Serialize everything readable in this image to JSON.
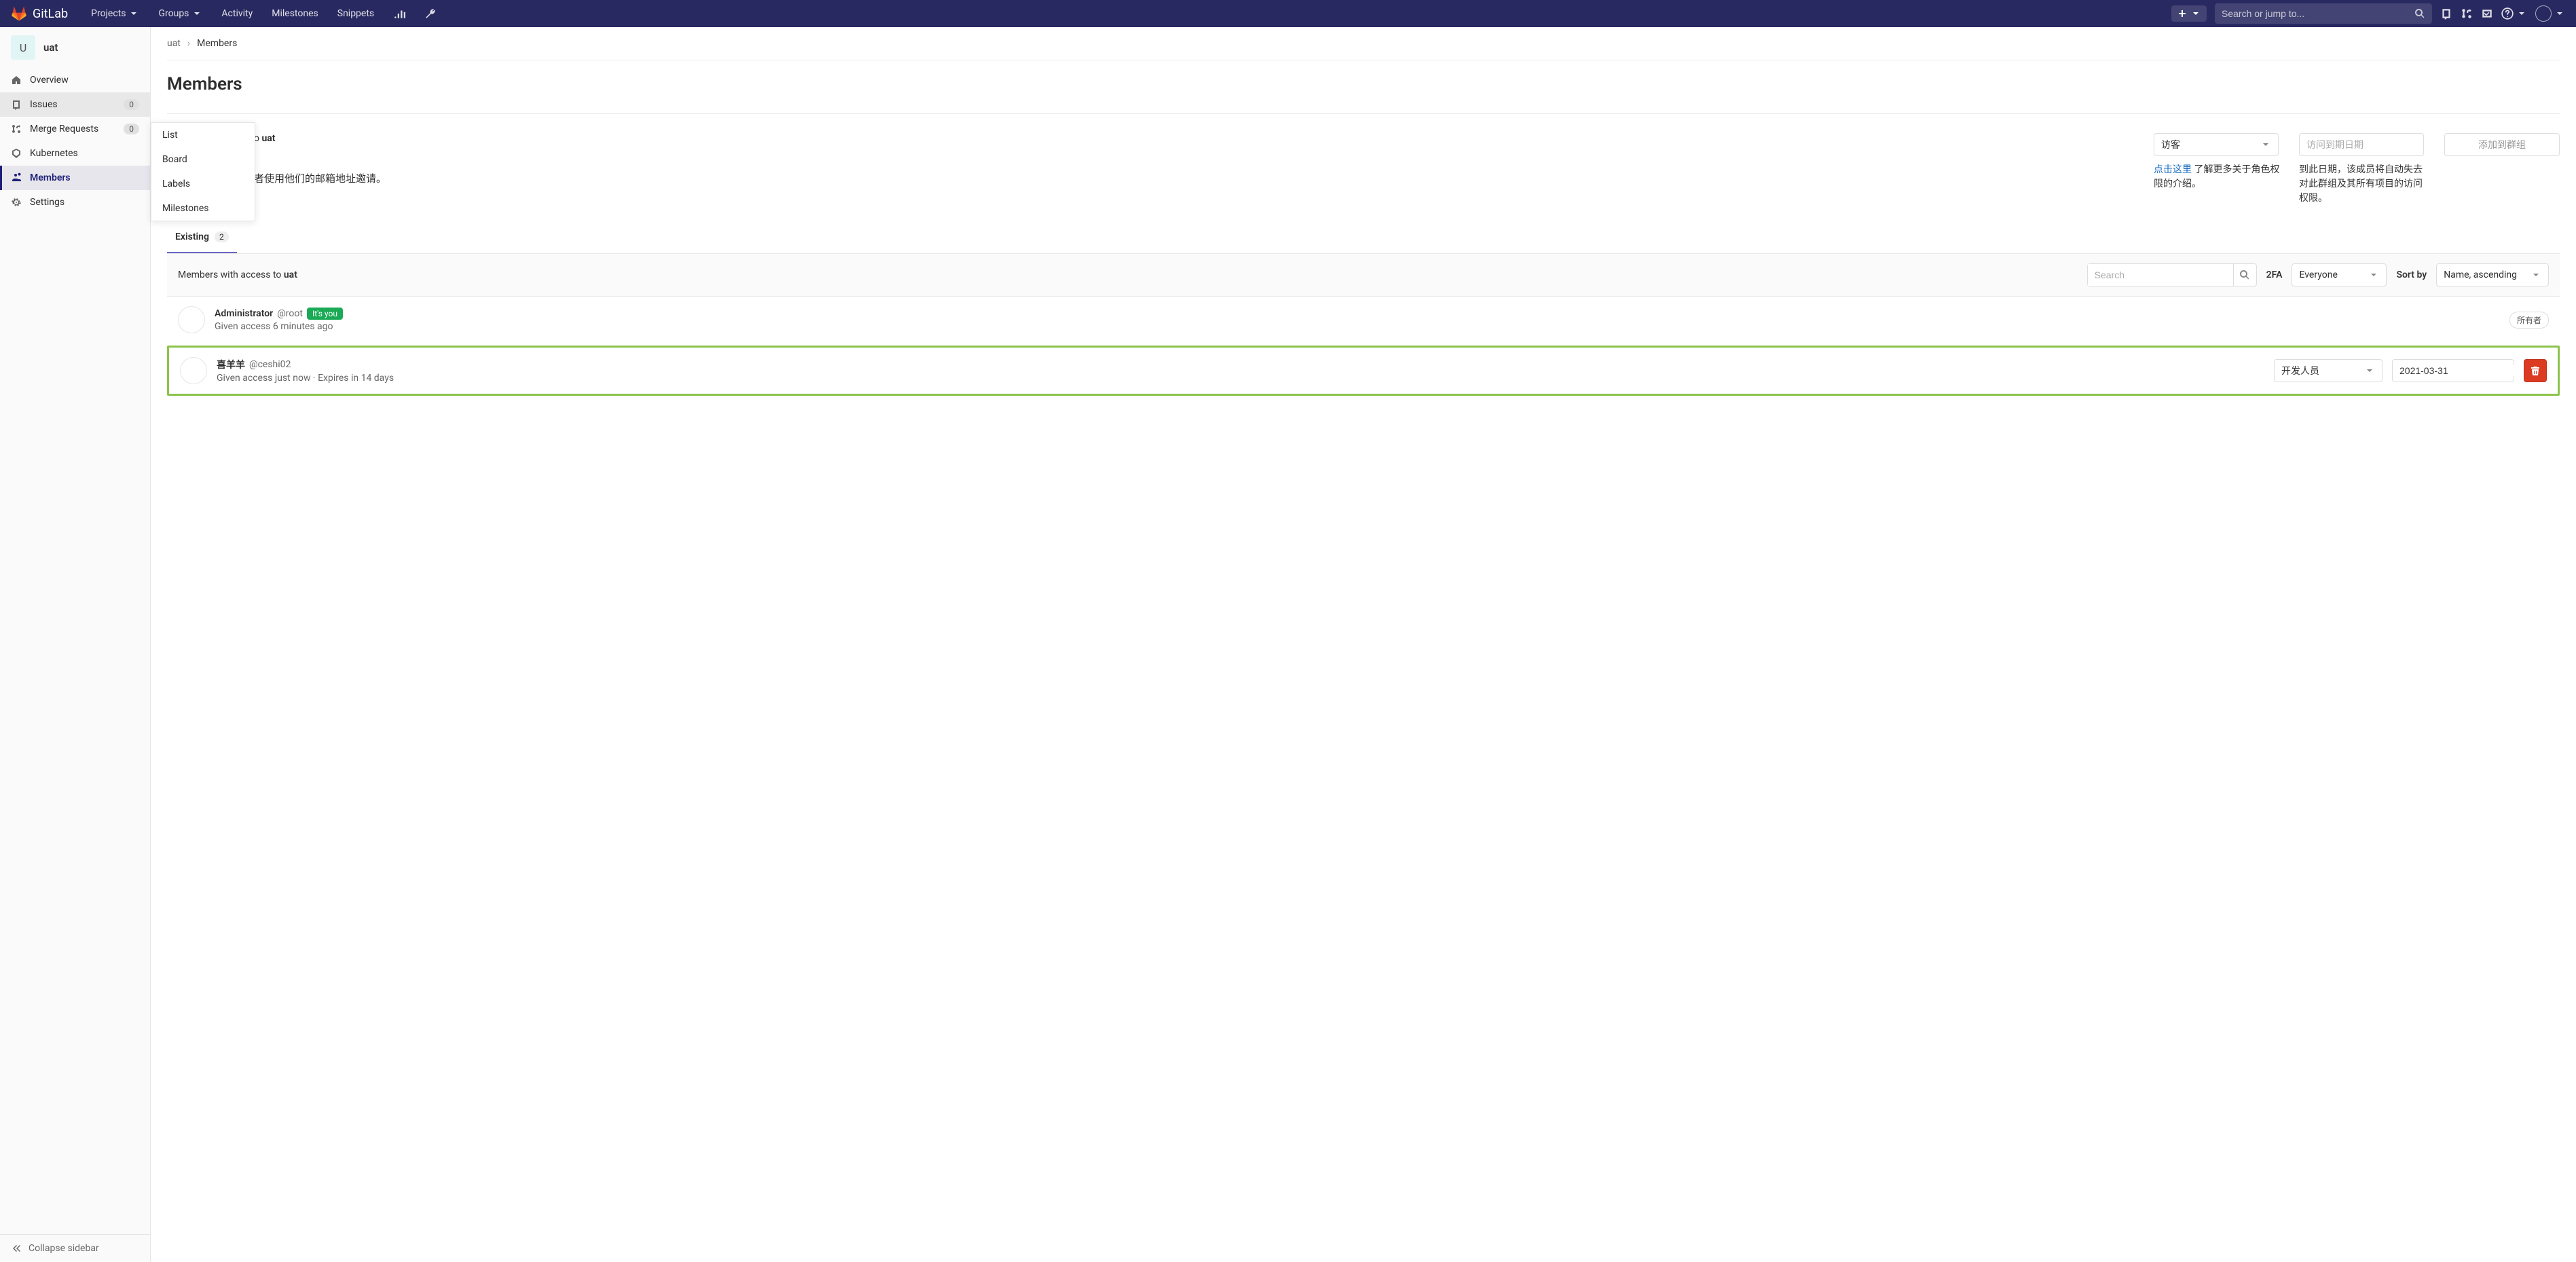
{
  "header": {
    "brand": "GitLab",
    "nav": {
      "projects": "Projects",
      "groups": "Groups",
      "activity": "Activity",
      "milestones": "Milestones",
      "snippets": "Snippets"
    },
    "search_placeholder": "Search or jump to..."
  },
  "sidebar": {
    "project_initial": "U",
    "project_name": "uat",
    "items": {
      "overview": {
        "label": "Overview"
      },
      "issues": {
        "label": "Issues",
        "badge": "0"
      },
      "merge_requests": {
        "label": "Merge Requests",
        "badge": "0"
      },
      "kubernetes": {
        "label": "Kubernetes"
      },
      "members": {
        "label": "Members"
      },
      "settings": {
        "label": "Settings"
      }
    },
    "collapse": "Collapse sidebar"
  },
  "flyout": {
    "list": "List",
    "board": "Board",
    "labels": "Labels",
    "milestones": "Milestones"
  },
  "breadcrumbs": {
    "root": "uat",
    "current": "Members"
  },
  "page": {
    "title": "Members"
  },
  "invite": {
    "text_suffix": "者使用他们的邮箱地址邀请。",
    "to_prefix": "o",
    "to_name": "uat",
    "role_select": "访客",
    "role_help_link": "点击这里",
    "role_help_rest": " 了解更多关于角色权限的介绍。",
    "expiry_placeholder": "访问到期日期",
    "expiry_help": "到此日期，该成员将自动失去对此群组及其所有项目的访问权限。",
    "add_btn": "添加到群组"
  },
  "tabs": {
    "existing": "Existing",
    "existing_count": "2"
  },
  "filter": {
    "prefix": "Members with access to ",
    "name": "uat",
    "search_placeholder": "Search",
    "two_fa_label": "2FA",
    "two_fa_value": "Everyone",
    "sort_label": "Sort by",
    "sort_value": "Name, ascending"
  },
  "members": [
    {
      "name": "Administrator",
      "handle": "@root",
      "you_badge": "It's you",
      "meta": "Given access 6 minutes ago",
      "owner_badge": "所有者",
      "highlighted": false
    },
    {
      "name": "喜羊羊",
      "handle": "@ceshi02",
      "meta": "Given access just now · Expires in 14 days",
      "role": "开发人员",
      "expiry": "2021-03-31",
      "highlighted": true
    }
  ]
}
